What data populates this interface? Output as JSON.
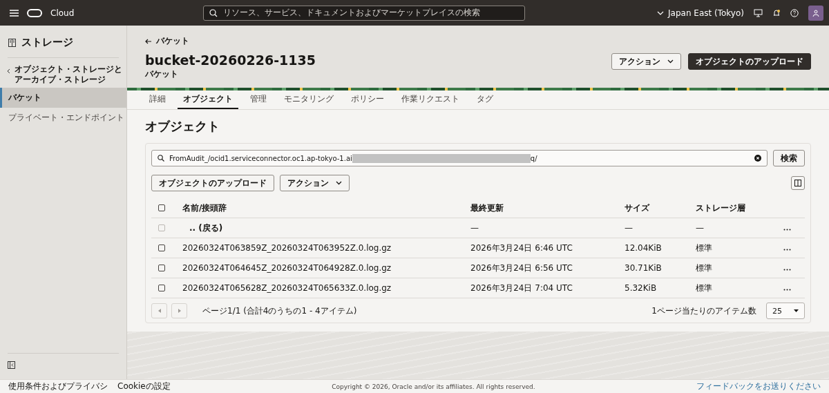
{
  "topbar": {
    "brand": "Cloud",
    "search_placeholder": "リソース、サービス、ドキュメントおよびマーケットプレイスの検索",
    "region": "Japan East (Tokyo)"
  },
  "sidebar": {
    "title": "ストレージ",
    "parent_link": "オブジェクト・ストレージとアーカイブ・ストレージ",
    "items": [
      {
        "label": "バケット",
        "selected": true
      },
      {
        "label": "プライベート・エンドポイント",
        "selected": false
      }
    ]
  },
  "header": {
    "back_link": "バケット",
    "title": "bucket-20260226-1135",
    "subtitle": "バケット",
    "actions_button": "アクション",
    "upload_button": "オブジェクトのアップロード"
  },
  "tabs": [
    {
      "label": "詳細",
      "selected": false
    },
    {
      "label": "オブジェクト",
      "selected": true
    },
    {
      "label": "管理",
      "selected": false
    },
    {
      "label": "モニタリング",
      "selected": false
    },
    {
      "label": "ポリシー",
      "selected": false
    },
    {
      "label": "作業リクエスト",
      "selected": false
    },
    {
      "label": "タグ",
      "selected": false
    }
  ],
  "section_title": "オブジェクト",
  "search": {
    "value_start": "FromAudit_/ocid1.serviceconnector.oc1.ap-tokyo-1.ai",
    "redacted": true,
    "value_end": "q/",
    "button": "検索"
  },
  "toolbar": {
    "upload_button": "オブジェクトのアップロード",
    "actions_button": "アクション"
  },
  "table": {
    "select_all_checked": false,
    "columns": [
      "名前/接頭辞",
      "最終更新",
      "サイズ",
      "ストレージ層"
    ],
    "rows": [
      {
        "kind": "parent",
        "name": ".. (戻る)",
        "modified": "—",
        "size": "—",
        "tier": "—",
        "checked": false,
        "disabled": true
      },
      {
        "kind": "object",
        "name": "20260324T063859Z_20260324T063952Z.0.log.gz",
        "modified": "2026年3月24日 6:46 UTC",
        "size": "12.04KiB",
        "tier": "標準",
        "checked": false,
        "disabled": false
      },
      {
        "kind": "object",
        "name": "20260324T064645Z_20260324T064928Z.0.log.gz",
        "modified": "2026年3月24日 6:56 UTC",
        "size": "30.71KiB",
        "tier": "標準",
        "checked": false,
        "disabled": false
      },
      {
        "kind": "object",
        "name": "20260324T065628Z_20260324T065633Z.0.log.gz",
        "modified": "2026年3月24日 7:04 UTC",
        "size": "5.32KiB",
        "tier": "標準",
        "checked": false,
        "disabled": false
      }
    ]
  },
  "pagination": {
    "summary": "ページ1/1 (合計4のうちの1 - 4アイテム)",
    "per_page_label": "1ページ当たりのアイテム数",
    "per_page": "25"
  },
  "footer": {
    "links": [
      "使用条件およびプライバシ",
      "Cookieの設定"
    ],
    "copyright": "Copyright © 2026, Oracle and/or its affiliates. All rights reserved.",
    "feedback": "フィードバックをお送りください"
  }
}
